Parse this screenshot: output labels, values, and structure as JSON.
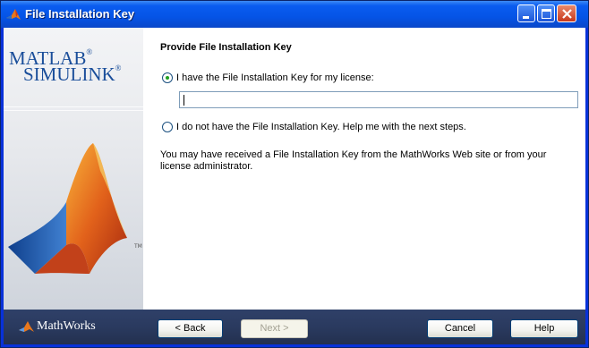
{
  "window": {
    "title": "File Installation Key",
    "controls": [
      "minimize",
      "maximize",
      "close"
    ]
  },
  "sidebar": {
    "brand_line1": "MATLAB",
    "brand_line2": "SIMULINK",
    "registered": "®",
    "trademark": "TM"
  },
  "main": {
    "heading": "Provide File Installation Key",
    "option_have_key": {
      "label": "I have the File Installation Key for my license:",
      "selected": true
    },
    "key_input": {
      "value": ""
    },
    "option_no_key": {
      "label": "I do not have the File Installation Key. Help me with the next steps.",
      "selected": false
    },
    "info_text": "You may have received a File Installation Key from the MathWorks Web site or from your license administrator."
  },
  "footer": {
    "company": "MathWorks",
    "buttons": {
      "back": "< Back",
      "next": "Next >",
      "cancel": "Cancel",
      "help": "Help"
    }
  },
  "colors": {
    "title_bar": "#0554e6",
    "footer_bg": "#2a3a5f",
    "brand_blue": "#1a4e9a",
    "radio_selected": "#21a121"
  },
  "icons": {
    "title_icon": "matlab-membrane-icon",
    "footer_icon": "mathworks-logo-icon"
  }
}
